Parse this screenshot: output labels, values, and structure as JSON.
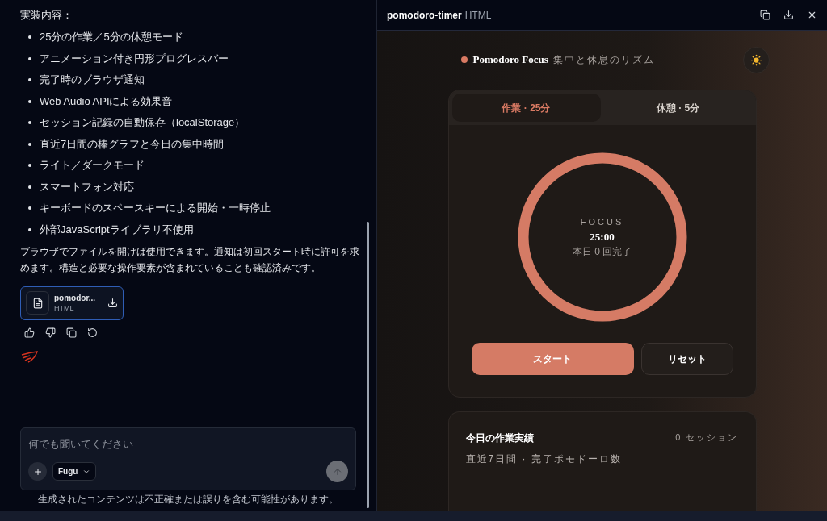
{
  "chat": {
    "heading": "実装内容：",
    "bullets": [
      "25分の作業／5分の休憩モード",
      "アニメーション付き円形プログレスバー",
      "完了時のブラウザ通知",
      "Web Audio APIによる効果音",
      "セッション記録の自動保存（localStorage）",
      "直近7日間の棒グラフと今日の集中時間",
      "ライト／ダークモード",
      "スマートフォン対応",
      "キーボードのスペースキーによる開始・一時停止",
      "外部JavaScriptライブラリ不使用"
    ],
    "paragraph": "ブラウザでファイルを開けば使用できます。通知は初回スタート時に許可を求めます。構造と必要な操作要素が含まれていることも確認済みです。",
    "file": {
      "name": "pomodor...",
      "type": "HTML"
    },
    "input": {
      "placeholder": "何でも聞いてください",
      "model": "Fugu"
    },
    "disclaimer": "生成されたコンテンツは不正確または誤りを含む可能性があります。"
  },
  "preview": {
    "title": "pomodoro-timer",
    "type": "HTML",
    "app": {
      "brand": "Pomodoro Focus",
      "tagline": "集中と休息のリズム",
      "tabs": [
        {
          "label": "作業 · 25分",
          "selected": true
        },
        {
          "label": "休憩 · 5分",
          "selected": false
        }
      ],
      "timer": {
        "mode": "FOCUS",
        "time": "25:00",
        "count": "本日 0 回完了",
        "level": 1
      },
      "buttons": [
        "スタート",
        "リセット"
      ],
      "stats": {
        "title": "今日の作業実績",
        "sessions": "0 セッション",
        "subtitle": "直近7日間 · 完了ポモドーロ数"
      }
    }
  }
}
